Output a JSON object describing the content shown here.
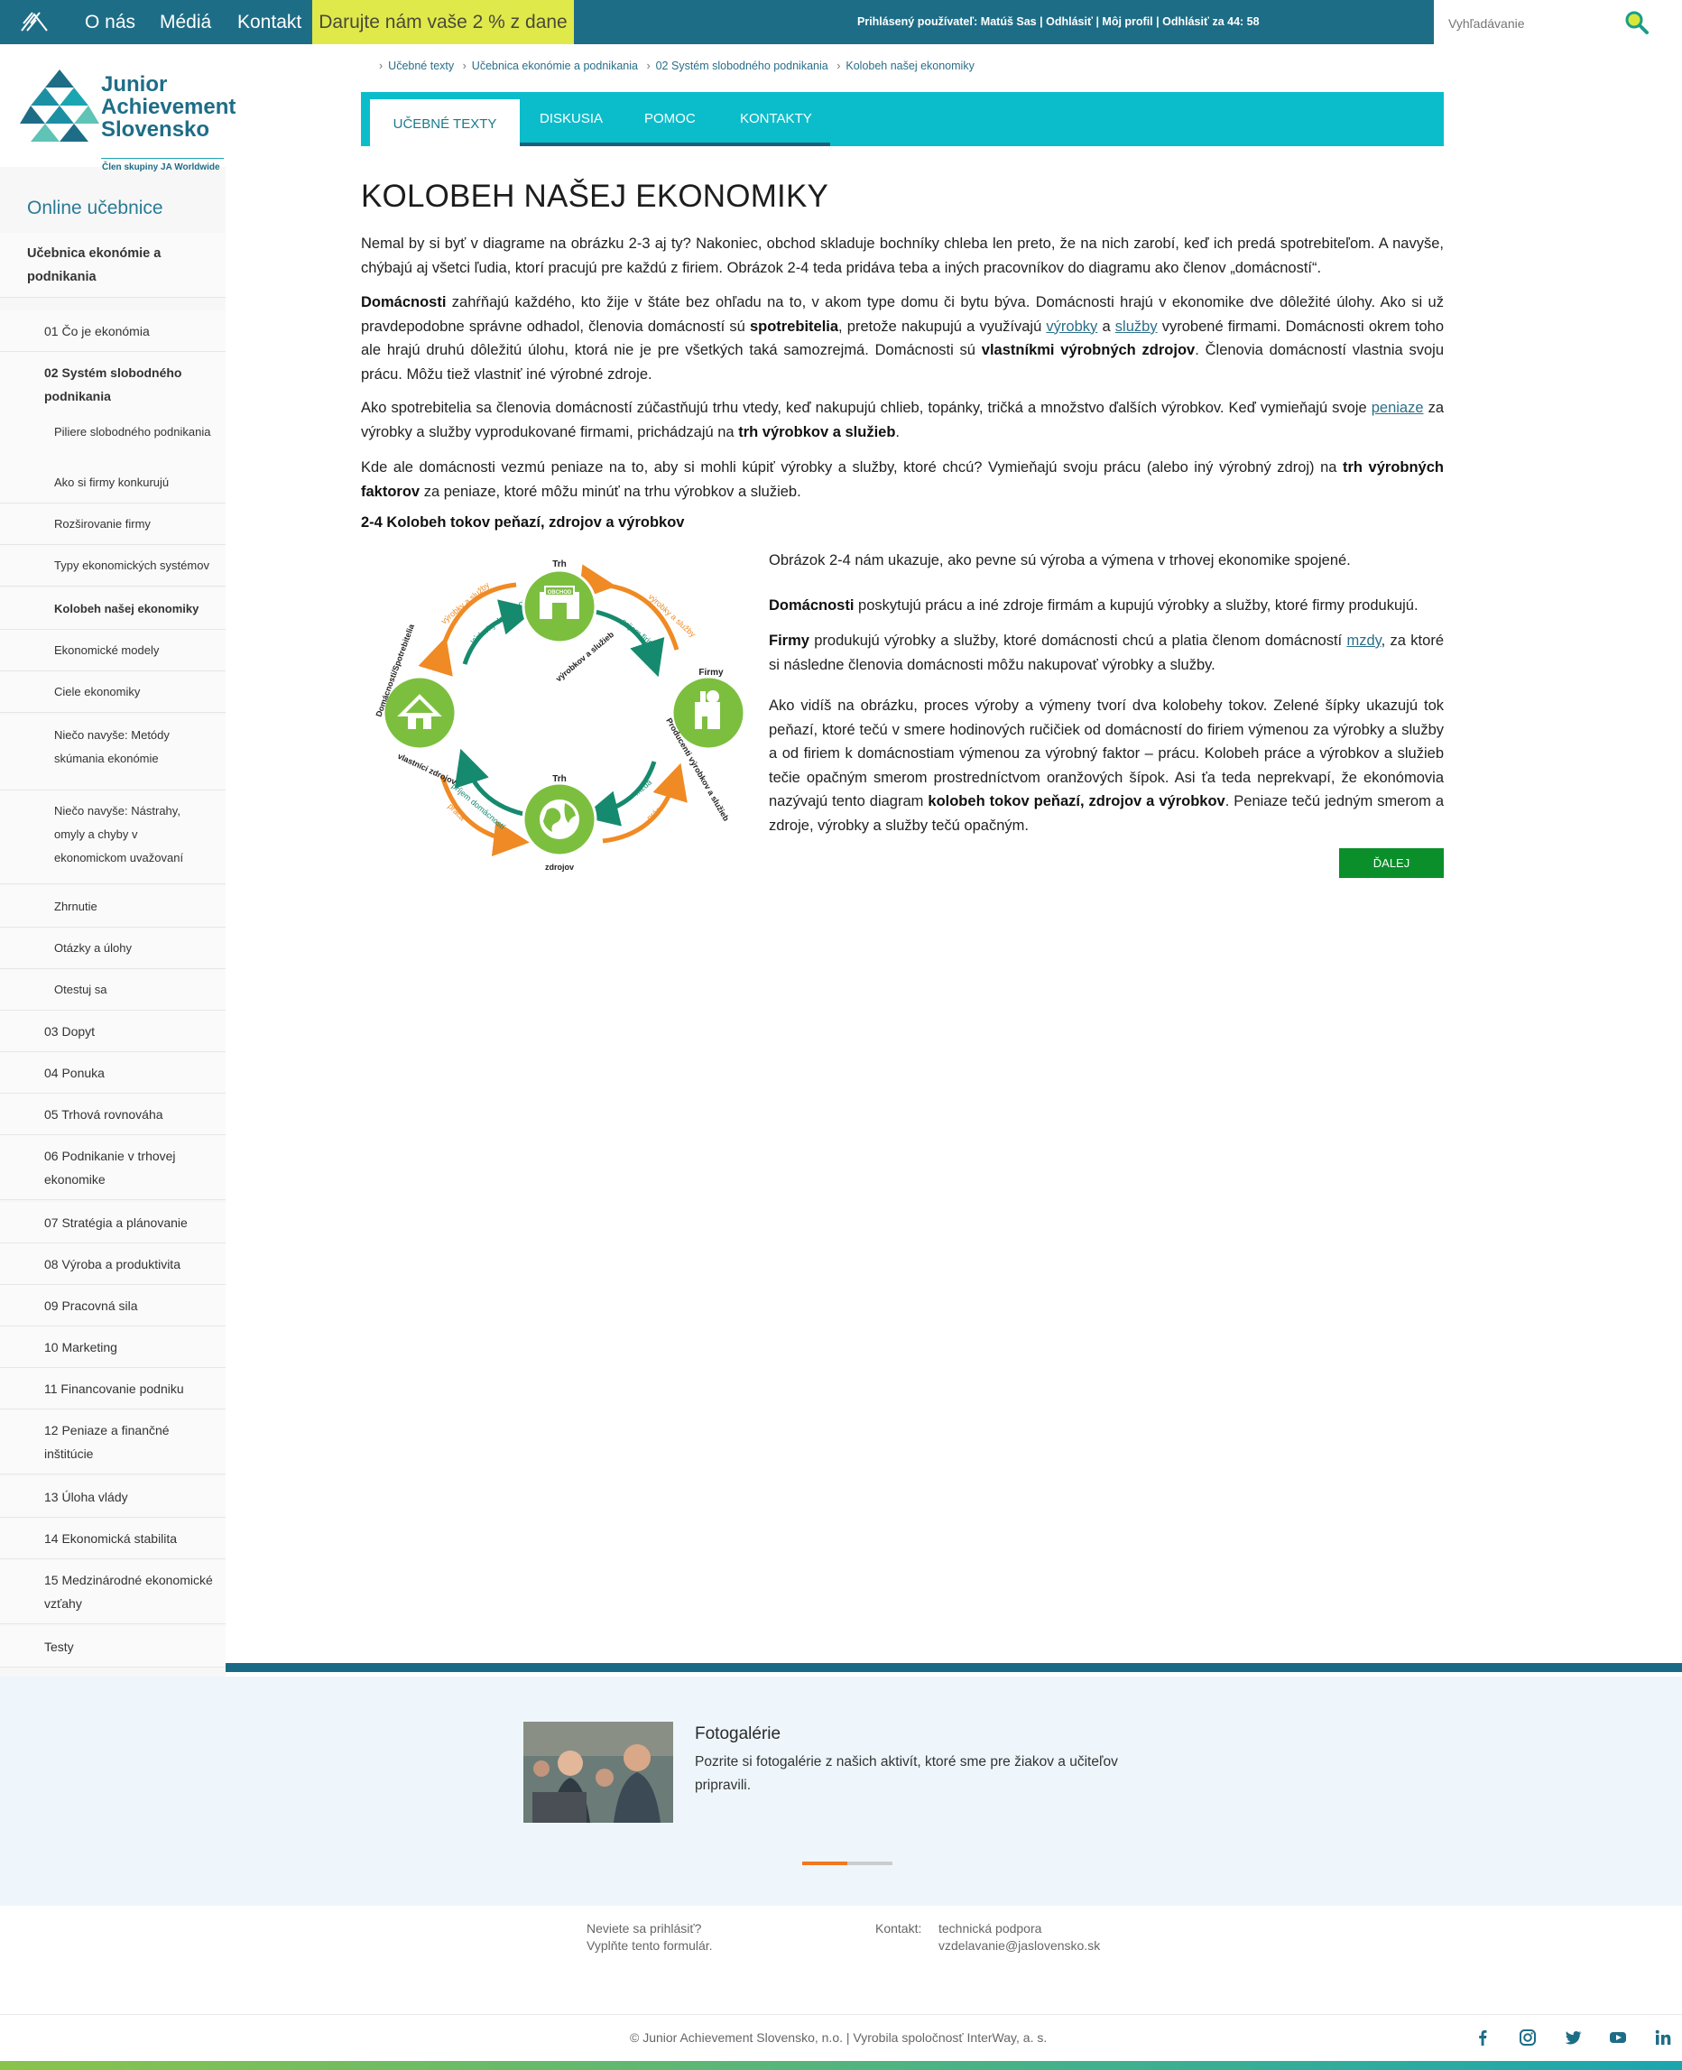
{
  "topbar": {
    "nav": [
      "O nás",
      "Médiá",
      "Kontakt"
    ],
    "donate": "Darujte nám vaše 2 % z dane",
    "user_prefix": "Prihlásený používateľ: Matúš Sas",
    "logout": "Odhlásiť",
    "profile": "Môj profil",
    "timeout": "Odhlásiť za 44: 58",
    "search_placeholder": "Vyhľadávanie"
  },
  "logo": {
    "line1": "Junior",
    "line2": "Achievement",
    "line3": "Slovensko",
    "tagline": "Člen skupiny JA Worldwide"
  },
  "sidebar": {
    "title": "Online učebnice",
    "items": [
      {
        "label": "Učebnica ekonómie a podnikania",
        "level": 0
      },
      {
        "label": "01 Čo je ekonómia",
        "level": 1
      },
      {
        "label": "02 Systém slobodného podnikania",
        "level": 1,
        "bold": true
      },
      {
        "label": "Piliere slobodného podnikania",
        "level": 2
      },
      {
        "label": "Ako si firmy konkurujú",
        "level": 2
      },
      {
        "label": "Rozširovanie firmy",
        "level": 2
      },
      {
        "label": "Typy ekonomických systémov",
        "level": 2
      },
      {
        "label": "Kolobeh našej ekonomiky",
        "level": 2,
        "bold": true
      },
      {
        "label": "Ekonomické modely",
        "level": 2
      },
      {
        "label": "Ciele ekonomiky",
        "level": 2
      },
      {
        "label": "Niečo navyše: Metódy skúmania ekonómie",
        "level": 2
      },
      {
        "label": "Niečo navyše: Nástrahy, omyly a chyby v ekonomickom uvažovaní",
        "level": 2
      },
      {
        "label": "Zhrnutie",
        "level": 2
      },
      {
        "label": "Otázky a úlohy",
        "level": 2
      },
      {
        "label": "Otestuj sa",
        "level": 2
      },
      {
        "label": "03 Dopyt",
        "level": 1
      },
      {
        "label": "04 Ponuka",
        "level": 1
      },
      {
        "label": "05 Trhová rovnováha",
        "level": 1
      },
      {
        "label": "06 Podnikanie v trhovej ekonomike",
        "level": 1
      },
      {
        "label": "07 Stratégia a plánovanie",
        "level": 1
      },
      {
        "label": "08 Výroba a produktivita",
        "level": 1
      },
      {
        "label": "09 Pracovná sila",
        "level": 1
      },
      {
        "label": "10 Marketing",
        "level": 1
      },
      {
        "label": "11 Financovanie podniku",
        "level": 1
      },
      {
        "label": "12 Peniaze a finančné inštitúcie",
        "level": 1
      },
      {
        "label": "13 Úloha vlády",
        "level": 1
      },
      {
        "label": "14 Ekonomická stabilita",
        "level": 1
      },
      {
        "label": "15 Medzinárodné ekonomické vzťahy",
        "level": 1
      },
      {
        "label": "Testy",
        "level": 1
      }
    ]
  },
  "breadcrumb": [
    "Učebné texty",
    "Učebnica ekonómie a podnikania",
    "02 Systém slobodného podnikania",
    "Kolobeh našej ekonomiky"
  ],
  "tabs": [
    "UČEBNÉ TEXTY",
    "DISKUSIA",
    "POMOC",
    "KONTAKTY"
  ],
  "page": {
    "title": "KOLOBEH NAŠEJ EKONOMIKY",
    "p1": "Nemal by si byť v diagrame na obrázku 2-3 aj ty? Nakoniec, obchod skladuje bochníky chleba len preto, že na nich zarobí, keď ich predá spotrebiteľom. A navyše, chýbajú aj všetci ľudia, ktorí pracujú pre každú z firiem. Obrázok 2-4 teda pridáva teba a iných pracovníkov do diagramu ako členov „domácností“.",
    "p2": {
      "b1": "Domácnosti",
      "t1": " zahŕňajú každého, kto žije v štáte bez ohľadu na to, v akom type domu či bytu býva. Domácnosti hrajú v ekonomike dve dôležité úlohy. Ako si už pravdepodobne správne odhadol, členovia domácností sú ",
      "b2": "spotrebitelia",
      "t2": ", pretože nakupujú a využívajú ",
      "l1": "výrobky",
      "t3": " a ",
      "l2": "služby",
      "t4": " vyrobené firmami. Domácnosti okrem toho ale hrajú druhú dôležitú úlohu, ktorá nie je pre všetkých taká samozrejmá. Domácnosti sú ",
      "b3": "vlastníkmi výrobných zdrojov",
      "t5": ". Členovia domácností vlastnia svoju prácu. Môžu tiež vlastniť iné výrobné zdroje."
    },
    "p3": {
      "t1": "Ako spotrebitelia sa členovia domácností zúčastňujú trhu vtedy, keď nakupujú chlieb, topánky, tričká a množstvo ďalších výrobkov. Keď vymieňajú svoje ",
      "l1": "peniaze",
      "t2": " za výrobky a služby vyprodukované firmami, prichádzajú na ",
      "b1": "trh výrobkov a služieb",
      "t3": "."
    },
    "p4": {
      "t1": "Kde ale domácnosti vezmú peniaze na to, aby si mohli kúpiť výrobky a služby, ktoré chcú? Vymieňajú svoju prácu (alebo iný výrobný zdroj) na ",
      "b1": "trh výrobných faktorov",
      "t2": " za peniaze, ktoré môžu minúť na trhu výrobkov a služieb."
    },
    "figure_title": "2-4 Kolobeh tokov peňazí, zdrojov a výrobkov",
    "r1": "Obrázok 2-4  nám ukazuje, ako pevne sú výroba a výmena v trhovej ekonomike spojené.",
    "r2": {
      "b1": "Domácnosti",
      "t1": " poskytujú prácu a iné zdroje firmám a kupujú výrobky a služby, ktoré firmy produkujú."
    },
    "r3": {
      "b1": "Firmy",
      "t1": " produkujú výrobky a služby, ktoré domácnosti chcú a platia členom domácností ",
      "l1": "mzdy",
      "t2": ", za ktoré si následne členovia domácnosti môžu nakupovať výrobky a služby."
    },
    "r4": {
      "t1": "Ako vidíš na obrázku, proces výroby a výmeny tvorí dva kolobehy tokov. Zelené šípky ukazujú tok peňazí, ktoré tečú v smere hodinových ručičiek od domácností do firiem výmenou za výrobky a služby a od firiem k domácnostiam výmenou za výrobný faktor – prácu. Kolobeh práce a výrobkov a služieb tečie opačným smerom prostredníctvom oranžových šípok. Asi ťa teda neprekvapí, že ekonómovia nazývajú tento diagram ",
      "b1": "kolobeh tokov peňazí, zdrojov a výrobkov",
      "t2": ". Peniaze tečú jedným smerom a zdroje, výrobky a služby tečú opačným."
    },
    "next": "ĎALEJ"
  },
  "diagram": {
    "top_label": "Trh",
    "top_sub": "výrobkov a služieb",
    "shop_sign": "OBCHOD",
    "left_label": "Domácnosti/Spotrebitelia",
    "left_sub": "vlastníci zdrojov",
    "right_label": "Firmy",
    "right_sub": "Producenti výrobkov a služieb",
    "bottom_label": "Trh",
    "bottom_sub": "zdrojov",
    "arrow_tl_orange": "výrobky a služby",
    "arrow_tl_green": "výdavky domácností",
    "arrow_tr_orange": "výrobky a služby",
    "arrow_tr_green": "príjem firiem",
    "arrow_bl_green": "príjem domácností",
    "arrow_bl_orange": "práca",
    "arrow_br_green": "mzda",
    "arrow_br_orange": "práca"
  },
  "promo": {
    "title": "Fotogalérie",
    "text": "Pozrite si fotogalérie z našich aktivít, ktoré sme pre žiakov a učiteľov pripravili."
  },
  "footer": {
    "login_q": "Neviete sa prihlásiť?",
    "login_a": "Vyplňte tento formulár.",
    "contact_label": "Kontakt:",
    "contact_1": "technická podpora",
    "contact_2": "vzdelavanie@jaslovensko.sk",
    "copyright": "© Junior Achievement Slovensko, n.o. | Vyrobila spoločnosť InterWay, a. s."
  },
  "colors": {
    "topbar": "#1e6d87",
    "tabs": "#0bbdcb",
    "donate": "#e0e94a",
    "accent_green": "#0a8f2a",
    "diagram_green": "#7cbf3f",
    "diagram_orange": "#f08a24",
    "diagram_teal": "#168a6e"
  }
}
